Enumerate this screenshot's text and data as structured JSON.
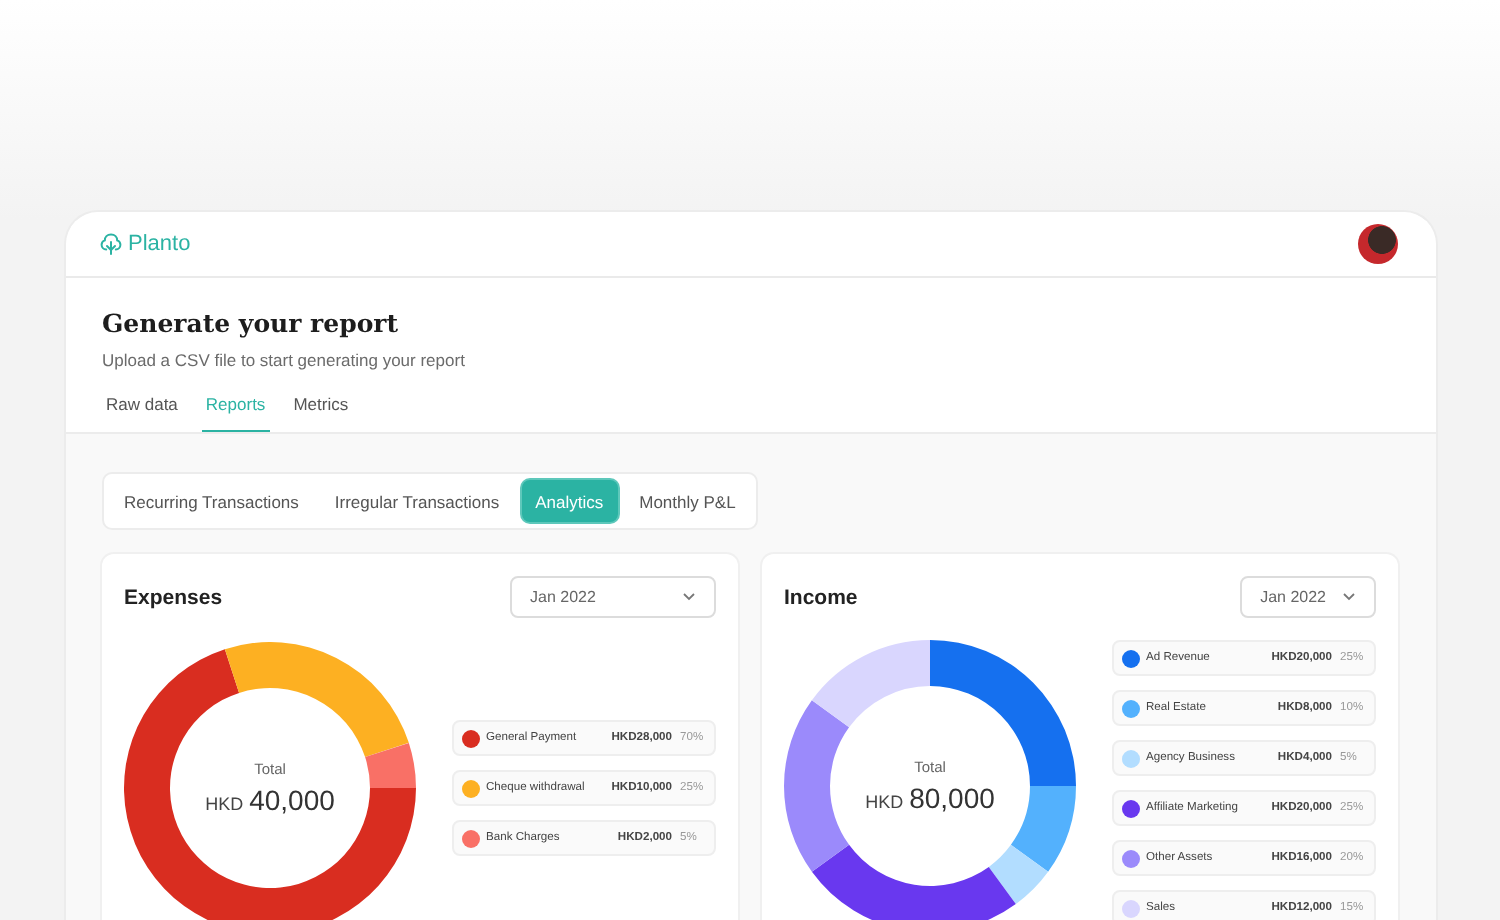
{
  "brand": {
    "name": "Planto"
  },
  "header": {
    "title": "Generate your report",
    "subtitle": "Upload a CSV file to start generating your report"
  },
  "tabs": [
    {
      "label": "Raw data",
      "selected": false
    },
    {
      "label": "Reports",
      "selected": true
    },
    {
      "label": "Metrics",
      "selected": false
    }
  ],
  "segments": [
    {
      "label": "Recurring Transactions",
      "selected": false
    },
    {
      "label": "Irregular Transactions",
      "selected": false
    },
    {
      "label": "Analytics",
      "selected": true
    },
    {
      "label": "Monthly P&L",
      "selected": false
    }
  ],
  "cards": [
    {
      "title": "Expenses",
      "period": "Jan 2022",
      "total_label": "Total",
      "currency": "HKD",
      "total": "40,000",
      "legend": [
        {
          "amount": "HKD28,000",
          "percent": "70%",
          "color": "#d92d20"
        },
        {
          "amount": "HKD10,000",
          "percent": "25%",
          "color": "#fdb022"
        },
        {
          "amount": "HKD2,000",
          "percent": "5%",
          "color": "#f97066"
        }
      ],
      "chart_data": {
        "type": "donut",
        "categories": [
          "General Payment",
          "Cheque withdrawal",
          "Bank Charges"
        ],
        "values": [
          70,
          25,
          5
        ]
      }
    },
    {
      "title": "Income",
      "period": "Jan 2022",
      "total_label": "Total",
      "currency": "HKD",
      "total": "80,000",
      "legend": [
        {
          "amount": "HKD20,000",
          "percent": "25%",
          "color": "#1570ef"
        },
        {
          "amount": "HKD8,000",
          "percent": "10%",
          "color": "#53b1fd"
        },
        {
          "amount": "HKD4,000",
          "percent": "5%",
          "color": "#b2ddff"
        },
        {
          "amount": "HKD20,000",
          "percent": "25%",
          "color": "#6938ef"
        },
        {
          "amount": "HKD16,000",
          "percent": "20%",
          "color": "#9b8afb"
        },
        {
          "amount": "HKD12,000",
          "percent": "15%",
          "color": "#d9d6fe"
        }
      ],
      "chart_data": {
        "type": "donut",
        "categories": [
          "Ad Revenue",
          "Real Estate",
          "Agency Business",
          "Affiliate Marketing",
          "Other Assets",
          "Sales"
        ],
        "values": [
          25,
          10,
          5,
          25,
          20,
          15
        ]
      }
    }
  ]
}
